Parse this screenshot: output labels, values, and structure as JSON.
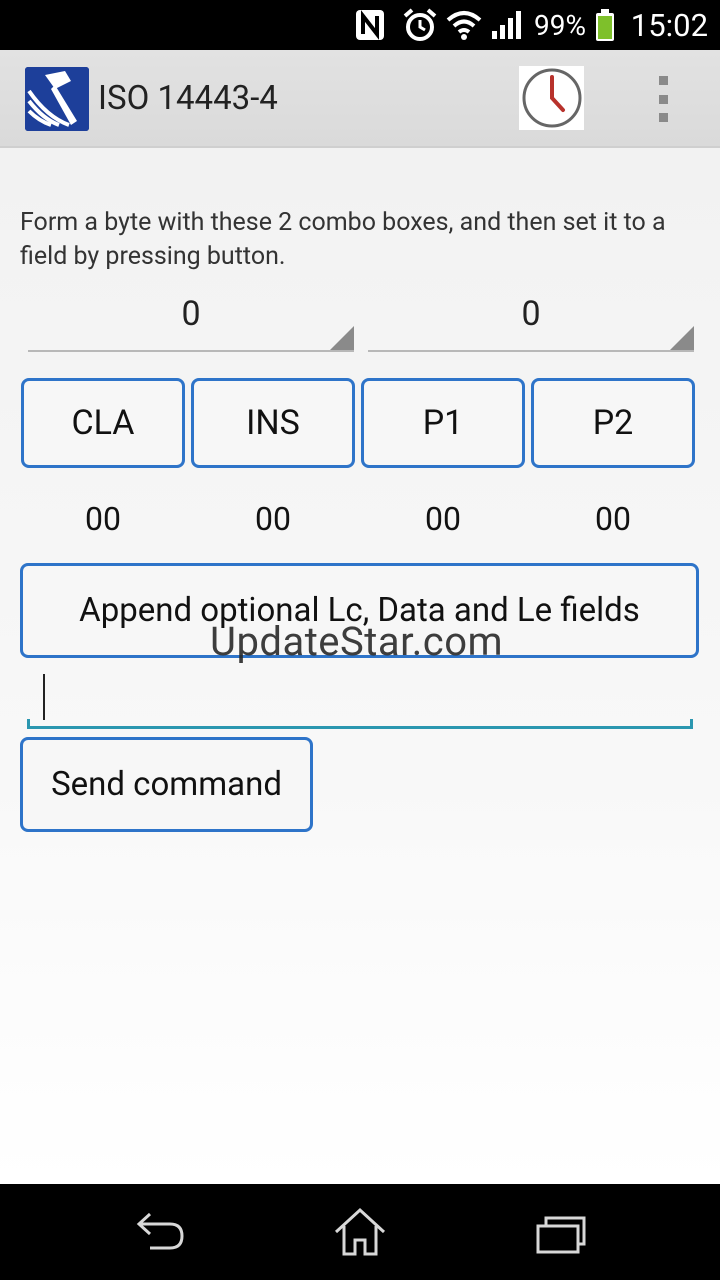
{
  "status_bar": {
    "battery_percent": "99%",
    "time": "15:02",
    "icons": [
      "nfc-icon",
      "alarm-icon",
      "wifi-icon",
      "signal-icon",
      "battery-icon"
    ]
  },
  "action_bar": {
    "title": "ISO 14443-4",
    "logo_icon": "nfc-tool-logo-icon",
    "history_icon": "clock-icon",
    "menu_icon": "overflow-menu-icon"
  },
  "main": {
    "instruction": "Form a byte with these 2 combo boxes, and then set it to a field by pressing button.",
    "spinner_high": "0",
    "spinner_low": "0",
    "fields": [
      {
        "label": "CLA",
        "value": "00"
      },
      {
        "label": "INS",
        "value": "00"
      },
      {
        "label": "P1",
        "value": "00"
      },
      {
        "label": "P2",
        "value": "00"
      }
    ],
    "append_label": "Append optional Lc, Data and Le fields",
    "data_input": "",
    "send_label": "Send command",
    "watermark": "UpdateStar.com"
  },
  "nav_bar": {
    "icons": [
      "back-icon",
      "home-icon",
      "recent-apps-icon"
    ]
  },
  "colors": {
    "accent_border": "#2e74c9",
    "input_underline": "#2b97b0",
    "status_bar_bg": "#000000",
    "action_bar_bg": "#dddddd"
  }
}
